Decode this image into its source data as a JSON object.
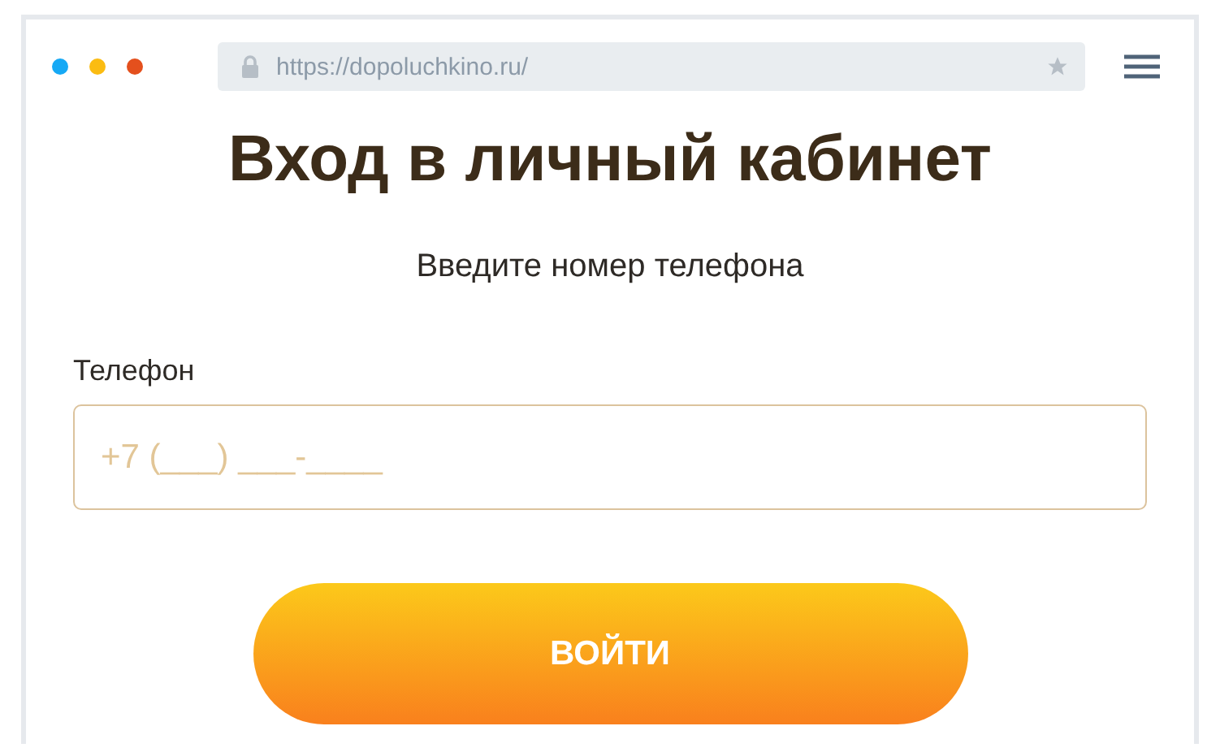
{
  "browser": {
    "url": "https://dopoluchkino.ru/",
    "window_dots": [
      {
        "color": "#16a9f5"
      },
      {
        "color": "#fbbc12"
      },
      {
        "color": "#e4501d"
      }
    ]
  },
  "title": "Вход в личный кабинет",
  "subtitle": "Введите номер телефона",
  "phone_field": {
    "label": "Телефон",
    "placeholder": "+7 (___) ___-____"
  },
  "login_button": "ВОЙТИ"
}
